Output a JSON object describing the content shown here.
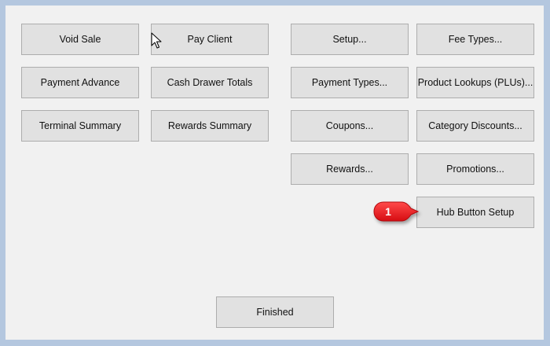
{
  "left_buttons": {
    "void_sale": "Void Sale",
    "pay_client": "Pay Client",
    "payment_advance": "Payment Advance",
    "cash_drawer_totals": "Cash Drawer Totals",
    "terminal_summary": "Terminal Summary",
    "rewards_summary": "Rewards Summary"
  },
  "right_buttons": {
    "setup": "Setup...",
    "fee_types": "Fee Types...",
    "payment_types": "Payment Types...",
    "product_lookups": "Product Lookups (PLUs)...",
    "coupons": "Coupons...",
    "category_discounts": "Category Discounts...",
    "rewards": "Rewards...",
    "promotions": "Promotions...",
    "hub_button_setup": "Hub Button Setup"
  },
  "footer": {
    "finished": "Finished"
  },
  "callout": {
    "number": "1",
    "color": "#e8141a",
    "icon": "arrow-callout-icon"
  },
  "cursor": {
    "icon": "mouse-pointer-icon"
  }
}
